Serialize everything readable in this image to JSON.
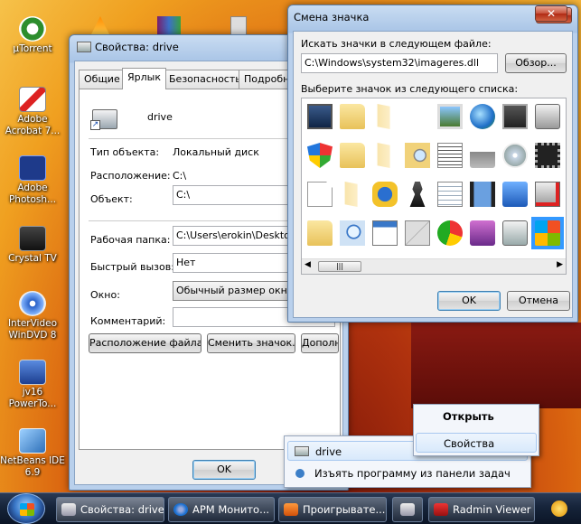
{
  "desktop": {
    "icons": [
      {
        "label": "µTorrent"
      },
      {
        "label": "Adobe\nAcrobat 7..."
      },
      {
        "label": "Adobe\nPhotosh..."
      },
      {
        "label": "Crystal TV"
      },
      {
        "label": "InterVideo\nWinDVD 8"
      },
      {
        "label": "jv16\nPowerTo..."
      },
      {
        "label": "NetBeans IDE\n6.9"
      }
    ]
  },
  "props": {
    "title": "Свойства: drive",
    "tabs": [
      "Общие",
      "Ярлык",
      "Безопасность",
      "Подробно"
    ],
    "active_tab": "Ярлык",
    "name": "drive",
    "type_label": "Тип объекта:",
    "type_value": "Локальный диск",
    "location_label": "Расположение:",
    "location_value": "C:\\",
    "target_label": "Объект:",
    "target_value": "C:\\",
    "workdir_label": "Рабочая папка:",
    "workdir_value": "C:\\Users\\erokin\\Desktop",
    "hotkey_label": "Быстрый вызов:",
    "hotkey_value": "Нет",
    "window_label": "Окно:",
    "window_value": "Обычный размер окна",
    "comment_label": "Комментарий:",
    "comment_value": "",
    "btn_file_location": "Расположение файла",
    "btn_change_icon": "Сменить значок...",
    "btn_advanced": "Дополнительно...",
    "btn_ok": "OK"
  },
  "icon_dialog": {
    "title": "Смена значка",
    "search_label": "Искать значки в следующем файле:",
    "path": "C:\\Windows\\system32\\imageres.dll",
    "browse": "Обзор...",
    "list_label": "Выберите значок из следующего списка:",
    "ok": "OK",
    "cancel": "Отмена",
    "icons": [
      "monitor-icon",
      "folder-icon",
      "folder-blank-icon",
      "empty",
      "picture-frame-icon",
      "globe-network-icon",
      "drive-card-icon",
      "network-drive-icon",
      "shield-icon",
      "folder-icon",
      "folder-blank-icon",
      "folder-search-icon",
      "music-sheet-icon",
      "printer-icon",
      "cd-drive-icon",
      "chip-icon",
      "document-icon",
      "folder-blank-icon",
      "puzzle-icon",
      "chess-icon",
      "text-document-icon",
      "film-icon",
      "control-panel-icon",
      "drive-x-icon",
      "folder-icon",
      "magnifier-doc-icon",
      "window-doc-icon",
      "mail-icon",
      "green-check-icon",
      "disk-icon",
      "drive-icon",
      "windows-logo-icon"
    ],
    "selected_index": 31
  },
  "jumplist": {
    "open": "Открыть",
    "properties": "Свойства",
    "pin_item": "drive",
    "unpin": "Изъять программу из панели задач"
  },
  "taskbar": {
    "items": [
      "Свойства: drive",
      "АРМ Монито...",
      "Проигрывате...",
      "",
      "Radmin Viewer"
    ]
  }
}
